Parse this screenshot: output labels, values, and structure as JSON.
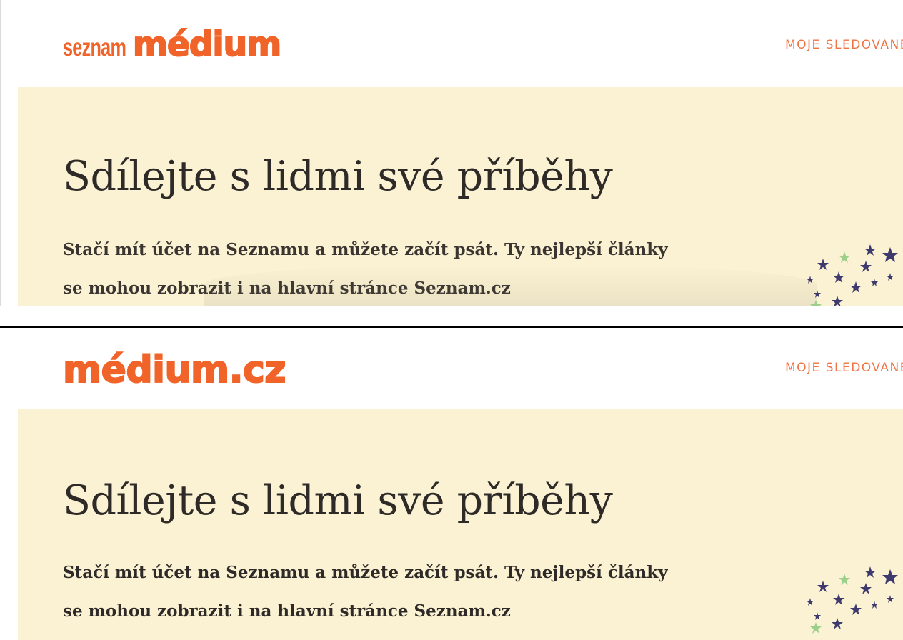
{
  "top": {
    "logo_small": "seznam",
    "logo_big": "médium",
    "nav_link": "MOJE SLEDOVANÉ",
    "hero_title": "Sdílejte s lidmi své příběhy",
    "hero_line1": "Stačí mít účet na Seznamu a můžete začít psát. Ty nejlepší články",
    "hero_line2": "se mohou zobrazit i na hlavní stránce Seznam.cz"
  },
  "bottom": {
    "logo_big": "médium.cz",
    "nav_link": "MOJE SLEDOVANÉ",
    "hero_title": "Sdílejte s lidmi své příběhy",
    "hero_line1": "Stačí mít účet na Seznamu a můžete začít psát. Ty nejlepší články",
    "hero_line2": "se mohou zobrazit i na hlavní stránce Seznam.cz"
  },
  "colors": {
    "brand_orange": "#f0642a",
    "hero_background": "#fbf2d3",
    "star_navy": "#3e3a6e",
    "star_green": "#9ccf8a"
  },
  "icons": [
    "stars-decoration-icon"
  ]
}
